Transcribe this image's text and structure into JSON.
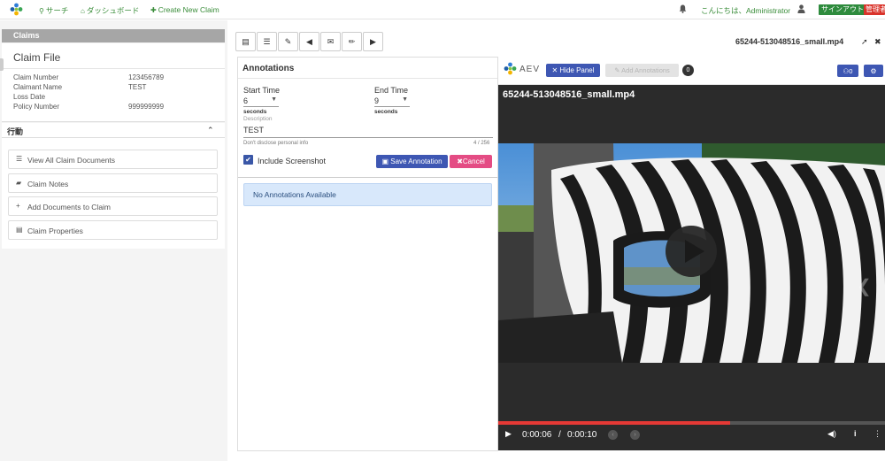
{
  "nav": {
    "search_label": "サーチ",
    "dashboard_label": "ダッシュボード",
    "create_label": "Create New Claim",
    "greeting": "こんにちは、Administrator",
    "signout_label": "サインアウト",
    "admin_label": "管理者"
  },
  "sidebar": {
    "section_title": "Claims",
    "claim_title": "Claim File",
    "fields": [
      {
        "label": "Claim Number",
        "value": "123456789"
      },
      {
        "label": "Claimant Name",
        "value": "TEST"
      },
      {
        "label": "Loss Date",
        "value": ""
      },
      {
        "label": "Policy Number",
        "value": "999999999"
      }
    ],
    "actions_title": "行動",
    "actions": [
      {
        "icon": "list-icon",
        "glyph": "☰",
        "label": "View All Claim Documents"
      },
      {
        "icon": "comment-icon",
        "glyph": "▰",
        "label": "Claim Notes"
      },
      {
        "icon": "plus-icon",
        "glyph": "+",
        "label": "Add Documents to Claim"
      },
      {
        "icon": "properties-icon",
        "glyph": "▤",
        "label": "Claim Properties"
      }
    ]
  },
  "toolbar": {
    "buttons": [
      {
        "icon": "document-icon",
        "glyph": "▤"
      },
      {
        "icon": "list-icon",
        "glyph": "☰"
      },
      {
        "icon": "edit-square-icon",
        "glyph": "✎"
      },
      {
        "icon": "megaphone-icon",
        "glyph": "◀"
      },
      {
        "icon": "envelope-icon",
        "glyph": "✉"
      },
      {
        "icon": "pencil-icon",
        "glyph": "✏"
      },
      {
        "icon": "play-icon",
        "glyph": "▶"
      }
    ],
    "file_title": "65244-513048516_small.mp4"
  },
  "annotations": {
    "title": "Annotations",
    "start_label": "Start Time",
    "start_value": "6",
    "start_unit": "seconds",
    "end_label": "End Time",
    "end_value": "9",
    "end_unit": "seconds",
    "description_label": "Description",
    "description_value": "TEST",
    "hint": "Don't disclose personal info",
    "counter": "4 / 256",
    "include_screenshot_label": "Include Screenshot",
    "include_screenshot_checked": true,
    "save_label": "Save Annotation",
    "cancel_label": "Cancel",
    "empty_message": "No Annotations Available"
  },
  "viewer": {
    "brand": "AEV",
    "hide_panel_label": "Hide Panel",
    "add_annotations_label": "Add Annotations",
    "annotation_count": "0",
    "users_count": "0",
    "video_filename": "65244-513048516_small.mp4",
    "current_time": "0:00:06",
    "time_separator": "/",
    "duration": "0:00:10",
    "progress_fraction": 0.6,
    "colors": {
      "accent": "#3e57b3",
      "progress": "#e53935",
      "cancel": "#e44c84",
      "nav_green": "#3a8d3a"
    }
  }
}
